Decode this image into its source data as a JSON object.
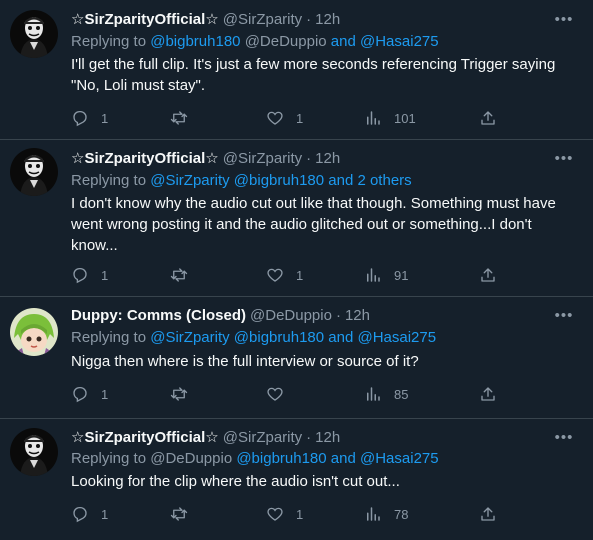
{
  "colors": {
    "background": "#15202b",
    "mention": "#1d9bf0",
    "muted": "#8b98a5",
    "divider": "#38444d"
  },
  "tweets": [
    {
      "name": "☆SirZparityOfficial☆",
      "handle": "@SirZparity",
      "dot": "·",
      "time": "12h",
      "replying_prefix": "Replying to",
      "mentions": [
        {
          "text": "@bigbruh180",
          "link": true
        },
        {
          "text": "@DeDuppio",
          "link": false
        },
        {
          "text": "and",
          "link": true
        },
        {
          "text": "@Hasai275",
          "link": true
        }
      ],
      "text": "I'll get the full clip. It's just a few more seconds referencing Trigger saying \"No, Loli must stay\".",
      "reply_count": "1",
      "retweet_count": "",
      "like_count": "1",
      "view_count": "101",
      "more_icon": "more-icon",
      "avatar": "masked-figure-avatar"
    },
    {
      "name": "☆SirZparityOfficial☆",
      "handle": "@SirZparity",
      "dot": "·",
      "time": "12h",
      "replying_prefix": "Replying to",
      "mentions": [
        {
          "text": "@SirZparity",
          "link": true
        },
        {
          "text": "@bigbruh180",
          "link": true
        },
        {
          "text": "and 2 others",
          "link": true
        }
      ],
      "text": "I don't know why the audio cut out like that though. Something must have went wrong posting it and the audio glitched out or something...I don't know...",
      "reply_count": "1",
      "retweet_count": "",
      "like_count": "1",
      "view_count": "91",
      "more_icon": "more-icon",
      "avatar": "masked-figure-avatar"
    },
    {
      "name": "Duppy: Comms (Closed)",
      "handle": "@DeDuppio",
      "dot": "·",
      "time": "12h",
      "replying_prefix": "Replying to",
      "mentions": [
        {
          "text": "@SirZparity",
          "link": true
        },
        {
          "text": "@bigbruh180",
          "link": true
        },
        {
          "text": "and",
          "link": true
        },
        {
          "text": "@Hasai275",
          "link": true
        }
      ],
      "text": "Nigga then where is the full interview or source of it?",
      "reply_count": "1",
      "retweet_count": "",
      "like_count": "",
      "view_count": "85",
      "more_icon": "more-icon",
      "avatar": "green-haired-anime-avatar"
    },
    {
      "name": "☆SirZparityOfficial☆",
      "handle": "@SirZparity",
      "dot": "·",
      "time": "12h",
      "replying_prefix": "Replying to",
      "mentions": [
        {
          "text": "@DeDuppio",
          "link": false
        },
        {
          "text": "@bigbruh180",
          "link": true
        },
        {
          "text": "and",
          "link": true
        },
        {
          "text": "@Hasai275",
          "link": true
        }
      ],
      "text": "Looking for the clip where the audio isn't cut out...",
      "reply_count": "1",
      "retweet_count": "",
      "like_count": "1",
      "view_count": "78",
      "more_icon": "more-icon",
      "avatar": "masked-figure-avatar"
    }
  ]
}
